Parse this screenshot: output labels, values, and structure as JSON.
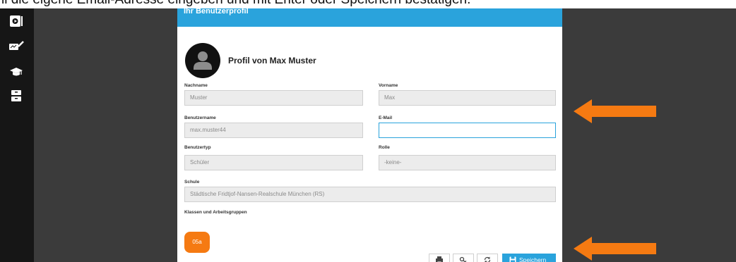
{
  "caption": {
    "text": "ll die eigene Email-Adresse eingeben und mit Enter oder Speichern bestätigen."
  },
  "sidebar": {
    "items": [
      {
        "icon": "presentation-icon"
      },
      {
        "icon": "pen-board-icon"
      },
      {
        "icon": "graduation-cap-icon"
      },
      {
        "icon": "archive-icon"
      }
    ]
  },
  "panel": {
    "header_title": "Ihr Benutzerprofil",
    "profile_title": "Profil von Max Muster",
    "fields": {
      "lastname": {
        "label": "Nachname",
        "value": "Muster"
      },
      "firstname": {
        "label": "Vorname",
        "value": "Max"
      },
      "username": {
        "label": "Benutzername",
        "value": "max.muster44"
      },
      "email": {
        "label": "E-Mail",
        "value": ""
      },
      "usertype": {
        "label": "Benutzertyp",
        "value": "Schüler"
      },
      "role": {
        "label": "Rolle",
        "value": "-keine-"
      },
      "school": {
        "label": "Schule",
        "value": "Städtische Fridtjof-Nansen-Realschule München (RS)"
      }
    },
    "groups_label": "Klassen und Arbeitsgruppen",
    "groups": [
      "05a"
    ],
    "buttons": {
      "print_icon": "printer-icon",
      "key_icon": "key-icon",
      "refresh_icon": "refresh-icon",
      "save_label": "Speichern"
    }
  },
  "colors": {
    "header": "#2aa3dc",
    "chip": "#f57a12",
    "arrow": "#f57a12",
    "sidebar": "#161616",
    "background": "#3b3b3b"
  }
}
